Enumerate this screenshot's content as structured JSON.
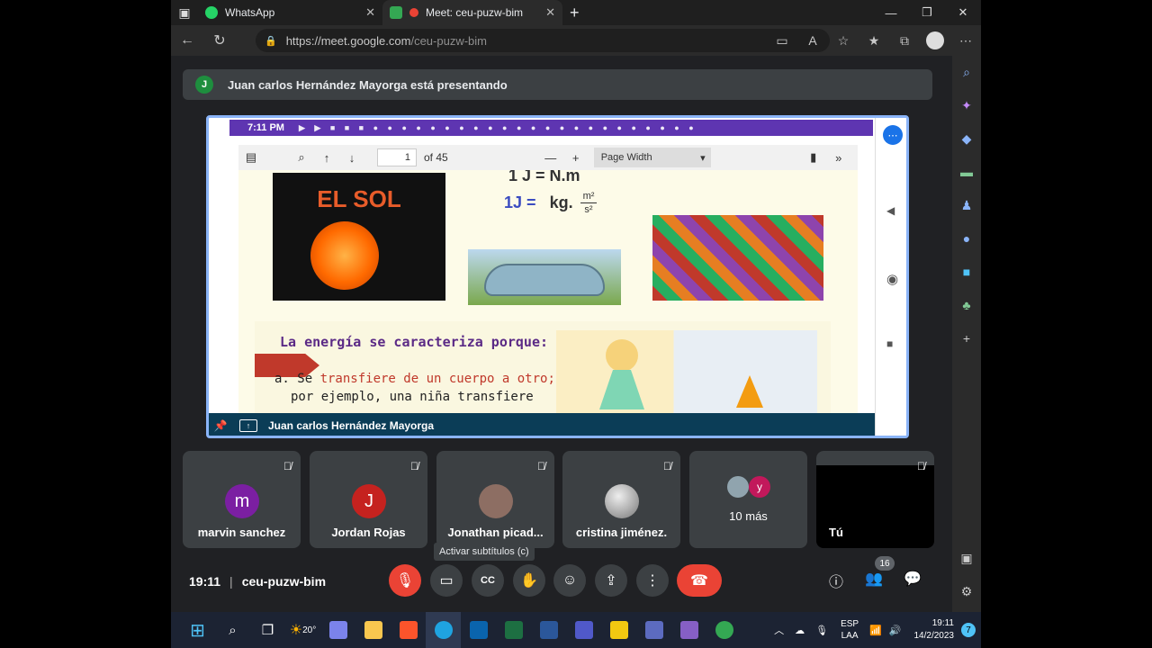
{
  "browser": {
    "tabs": [
      {
        "label": "WhatsApp"
      },
      {
        "label": "Meet: ceu-puzw-bim"
      }
    ],
    "url": {
      "scheme_host": "https://meet.google.com",
      "path": "/ceu-puzw-bim"
    }
  },
  "meet": {
    "banner": {
      "initial": "J",
      "text": "Juan carlos Hernández Mayorga está presentando"
    },
    "presentation": {
      "phone_time": "7:11 PM",
      "pdf": {
        "page": "1",
        "of_pages": "of 45",
        "zoom": "Page Width"
      },
      "doc": {
        "sol_title": "EL SOL",
        "formula1": "1 J = N.m",
        "formula2_left": "1J =",
        "formula2_unit": "kg.",
        "frac_num": "m²",
        "frac_den": "s²",
        "caract": "La energía se caracteriza porque:",
        "line_a_prefix": "a. Se ",
        "line_a_red": "transfiere de un cuerpo a otro;",
        "line_b": "por ejemplo, una niña transfiere"
      },
      "presenter": "Juan carlos Hernández Mayorga"
    },
    "tiles": [
      {
        "name": "marvin sanchez",
        "initial": "m",
        "color": "#7b1fa2"
      },
      {
        "name": "Jordan Rojas",
        "initial": "J",
        "color": "#c5221f"
      },
      {
        "name": "Jonathan picad...",
        "initial": "",
        "color": "#8d6e63"
      },
      {
        "name": "cristina jiménez.",
        "initial": "",
        "color": "#9e9e9e"
      },
      {
        "name": "10 más",
        "initial": "y",
        "color": "#c2185b"
      },
      {
        "name": "Tú",
        "initial": "",
        "color": "#000000"
      }
    ],
    "tooltip": "Activar subtítulos (c)",
    "bottom": {
      "time": "19:11",
      "code": "ceu-puzw-bim",
      "people_count": "16"
    }
  },
  "taskbar": {
    "weather": "20°",
    "lang": [
      "ESP",
      "LAA"
    ],
    "clock_time": "19:11",
    "clock_date": "14/2/2023",
    "notif": "7"
  },
  "colors": {
    "accent": "#8ab4f8",
    "danger": "#ea4335",
    "meet_bg": "#202124"
  }
}
